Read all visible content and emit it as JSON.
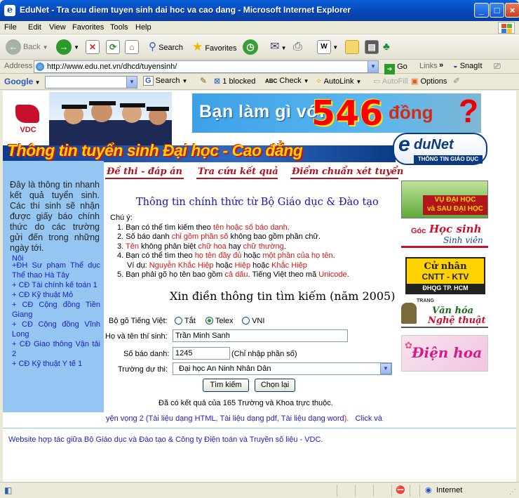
{
  "window": {
    "title": "EduNet - Tra cuu diem tuyen sinh dai hoc va cao dang - Microsoft Internet Explorer"
  },
  "menu": [
    "File",
    "Edit",
    "View",
    "Favorites",
    "Tools",
    "Help"
  ],
  "toolbar": {
    "back": "Back",
    "search": "Search",
    "favorites": "Favorites"
  },
  "address": {
    "label": "Address",
    "url": "http://www.edu.net.vn/dhcd/tuyensinh/",
    "go": "Go",
    "links": "Links",
    "snagit": "SnagIt"
  },
  "googlebar": {
    "brand": "Google",
    "search": "Search",
    "blocked": "1 blocked",
    "check": "Check",
    "autolink": "AutoLink",
    "autofill": "AutoFill",
    "options": "Options"
  },
  "header": {
    "vdc": "VDC",
    "banner_text1": "Bạn làm gì với",
    "banner_number": "546",
    "banner_text2": "đồng",
    "banner_q": "?",
    "site_title": "Thông tin tuyển sinh Đại học - Cao đẳng",
    "edunet_e": "e",
    "edunet_net": "duNet",
    "edunet_sub": "THÔNG TIN GIÁO DỤC"
  },
  "nav": [
    "Đề thi - đáp án",
    "Tra cứu kết quả",
    "Điểm chuẩn xét tuyển"
  ],
  "sidebar": {
    "intro": "Đây là thông tin nhanh kết quả tuyển sinh. Các thí sinh sẽ nhận được giấy báo chính thức do các trường gửi đến trong những ngày tới.",
    "partial": "Nội",
    "links": [
      "+ĐH Sư phạm Thể dục Thể thao Hà Tây",
      "+ CĐ Tài chính kế toán 1",
      "+ CĐ Kỹ thuật Mỏ",
      "+ CĐ Cộng đồng Tiền Giang",
      "+ CĐ Cộng đồng Vĩnh Long",
      "+ CĐ Giao thông Vận tải 2",
      "+ CĐ Kỹ thuật Y tế 1"
    ]
  },
  "main": {
    "title": "Thông tin chính thức từ Bộ Giáo dục & Đào tạo",
    "note_label": "Chú ý:",
    "notes": {
      "n1a": "1. Bạn có thể tìm kiếm theo ",
      "n1b": "tên",
      "n1c": " hoặc ",
      "n1d": "số báo danh",
      "n1e": ".",
      "n2a": "2. Số báo danh ",
      "n2b": "chỉ gồm phần số",
      "n2c": " không bao gồm phần chữ.",
      "n3a": "3. ",
      "n3b": "Tên",
      "n3c": " không phân biệt ",
      "n3d": "chữ hoa",
      "n3e": " hay ",
      "n3f": "chữ thường",
      "n3g": ".",
      "n4a": "4. Bạn có thể tìm theo ",
      "n4b": "họ tên đầy đủ",
      "n4c": " hoặc ",
      "n4d": "một phần của họ tên",
      "n4e": ".",
      "n4f": "Ví dụ: ",
      "n4g": "Nguyễn Khắc Hiệp",
      "n4h": " hoặc ",
      "n4i": "Hiệp",
      "n4j": " hoặc ",
      "n4k": "Khắc Hiệp",
      "n5a": "5. Bạn phải gõ họ tên bao gồm ",
      "n5b": "cả dấu",
      "n5c": ". Tiếng Việt theo mã ",
      "n5d": "Unicode",
      "n5e": "."
    },
    "form_title": "Xin điền thông tin tìm kiếm (năm 2005)",
    "typing_label": "Bộ gõ Tiếng Việt:",
    "typing_options": [
      "Tắt",
      "Telex",
      "VNI"
    ],
    "name_label": "Họ và tên thí sinh:",
    "name_value": "Trần Minh Sanh",
    "sbd_label": "Số báo danh:",
    "sbd_value": "1245",
    "sbd_hint": "(Chỉ nhập phần số)",
    "school_label": "Trường dự thi:",
    "school_value": "Đại học An Ninh Nhân Dân",
    "search_btn": "Tìm kiếm",
    "reset_btn": "Chọn lại",
    "result": "Đã có kết quả của 165 Trường và Khoa trực thuộc.",
    "links_row": {
      "a": "yện vọng 2 (",
      "b": "Tài liệu dạng HTML",
      "c": ", ",
      "d": "Tài liệu dạng pdf",
      "e": ", ",
      "f": "Tài liệu dạng word",
      "g": ").",
      "h": "Click và"
    },
    "footer": "Website hợp tác giữa Bộ Giáo dục và Đào tạo & Công ty Điện toán và Truyền số liệu - VDC."
  },
  "right_banners": {
    "b1_line1": "VỤ ĐẠI HỌC",
    "b1_line2": "và SAU ĐẠI HỌC",
    "b2_goc": "Góc",
    "b2_hs": "Học sinh",
    "b2_sv": "Sinh viên",
    "b3_line1": "Cử nhân",
    "b3_line2": "CNTT - KTV",
    "b3_line3": "ĐHQG TP. HCM",
    "b4_trang": "TRANG",
    "b4_vh": "Văn hóa",
    "b4_nt": "Nghệ thuật",
    "b5": "Điện hoa"
  },
  "status": {
    "zone": "Internet"
  }
}
